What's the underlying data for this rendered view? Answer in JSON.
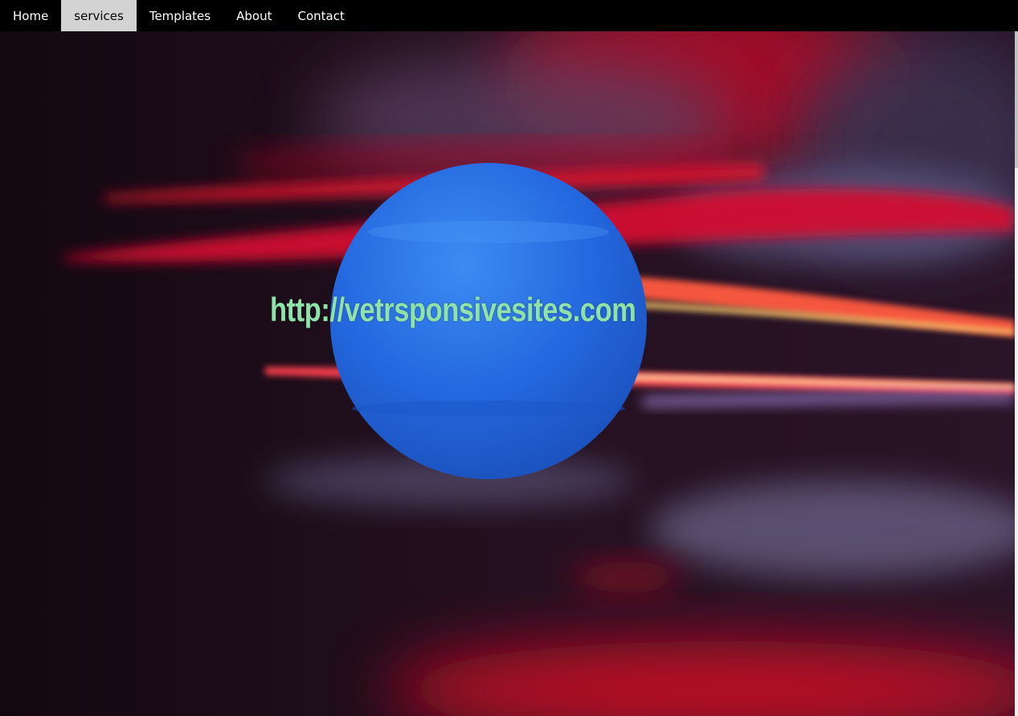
{
  "nav": {
    "items": [
      {
        "label": "Home",
        "active": false
      },
      {
        "label": "services",
        "active": true
      },
      {
        "label": "Templates",
        "active": false
      },
      {
        "label": "About",
        "active": false
      },
      {
        "label": "Contact",
        "active": false
      }
    ]
  },
  "hero": {
    "url_text": "http://vetrsponsivesites.com"
  },
  "colors": {
    "nav_background": "#000000",
    "nav_active_background": "#d3d3d3",
    "url_text": "#8fe3a8",
    "sphere": "#2a6fe0",
    "streak_red": "#e0152e"
  }
}
